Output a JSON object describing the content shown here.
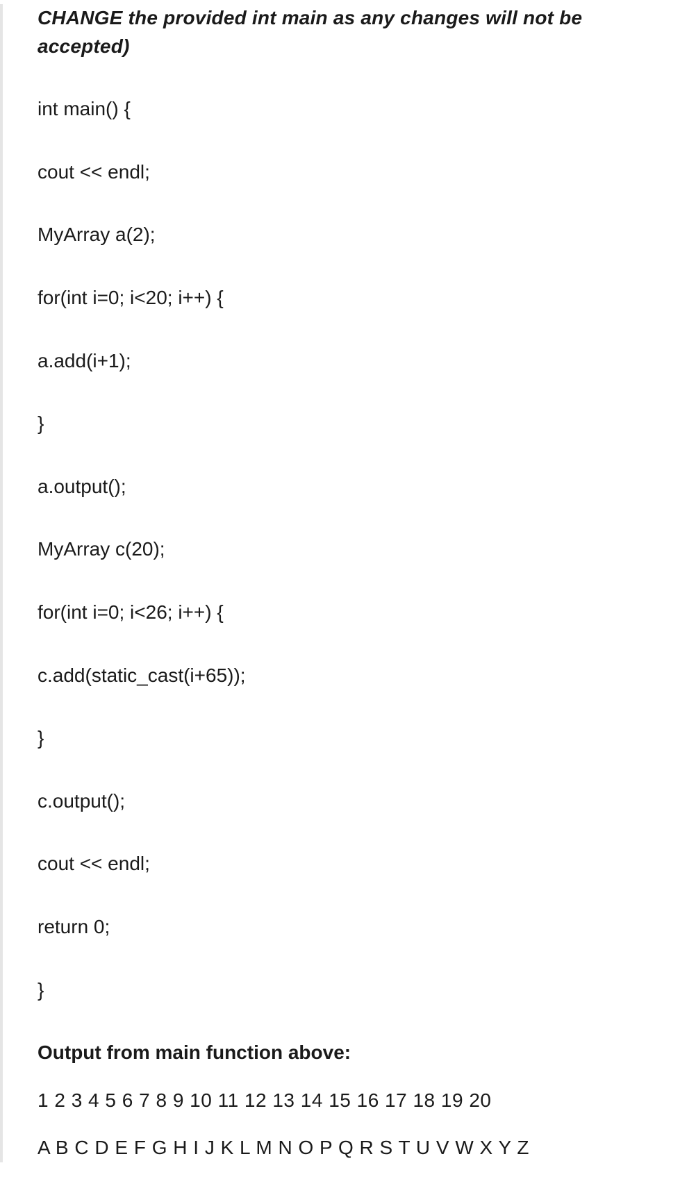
{
  "title": "CHANGE the provided int main as any changes will not be accepted)",
  "code_lines": [
    "int main() {",
    "cout << endl;",
    "MyArray a(2);",
    "for(int i=0; i<20; i++) {",
    "a.add(i+1);",
    "}",
    "a.output();",
    "MyArray c(20);",
    "for(int i=0; i<26; i++) {",
    "c.add(static_cast(i+65));",
    "}",
    "c.output();",
    "cout << endl;",
    "return 0;",
    "}"
  ],
  "output_label": "Output from main function above:",
  "output_lines": [
    "1 2 3 4 5 6 7 8 9 10 11 12 13 14 15 16 17 18 19 20",
    "A B C D E F G H I J K L M N O P Q R S T U V W X Y Z"
  ]
}
